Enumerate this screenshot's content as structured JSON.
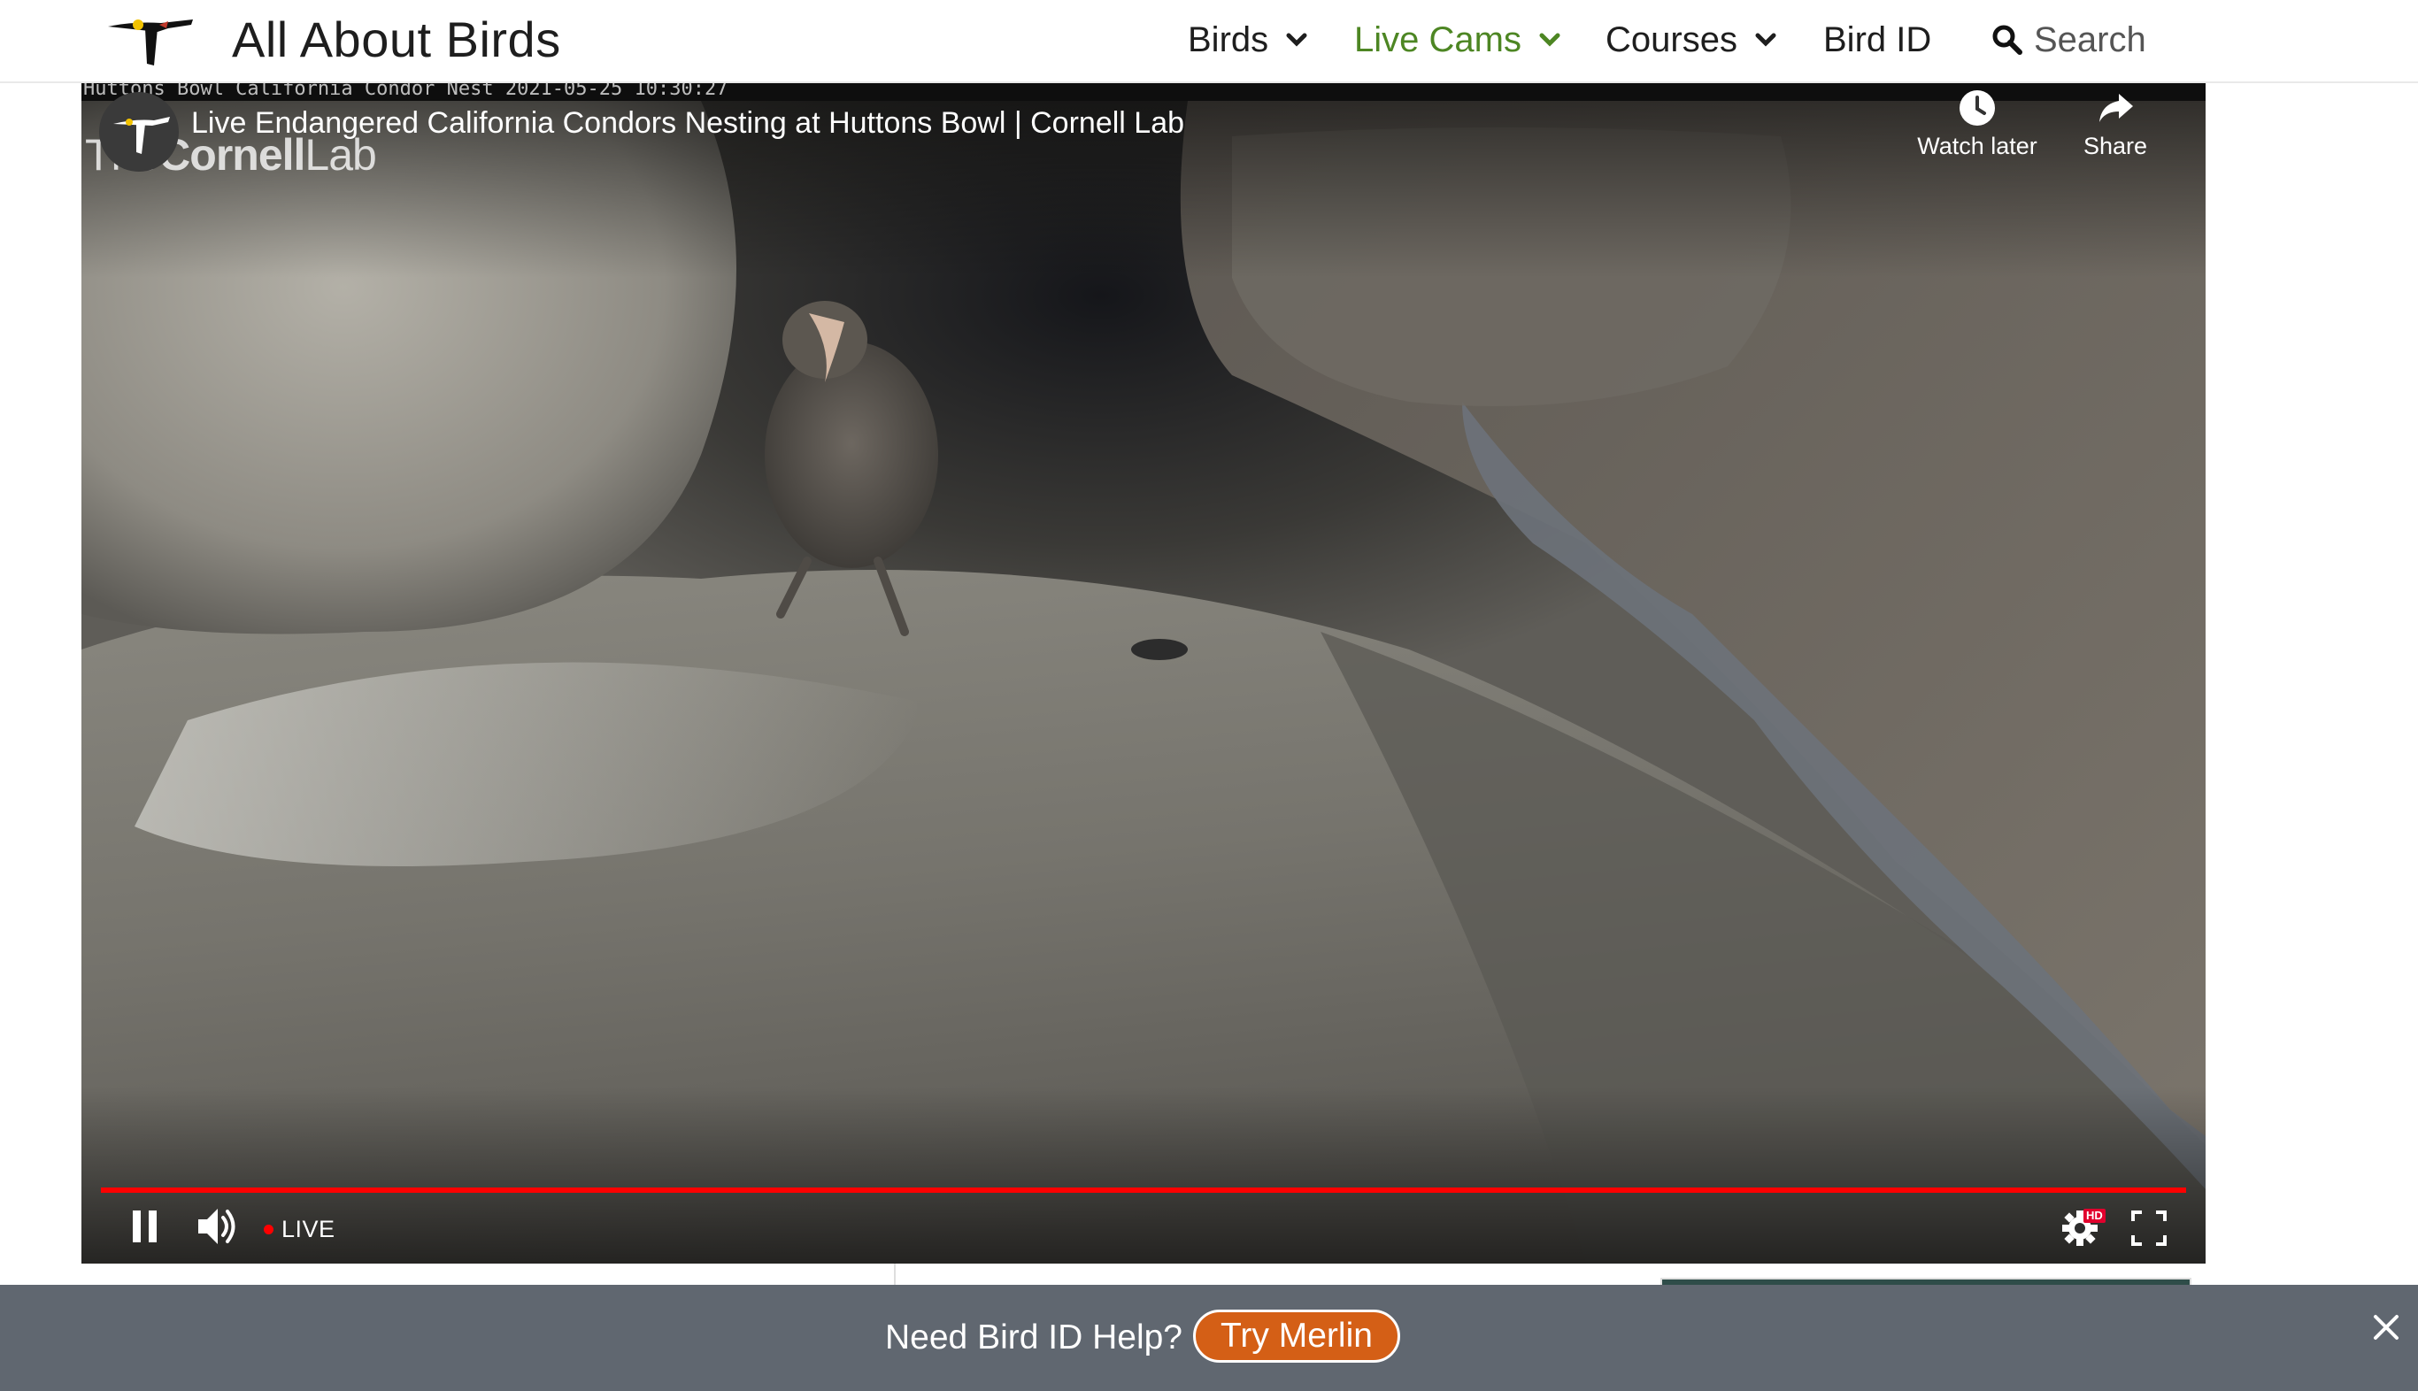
{
  "site": {
    "title": "All About Birds",
    "logo_icon": "cornell-lab-bird-logo-icon"
  },
  "nav": {
    "items": [
      {
        "label": "Birds",
        "has_dropdown": true,
        "active": false
      },
      {
        "label": "Live Cams",
        "has_dropdown": true,
        "active": true
      },
      {
        "label": "Courses",
        "has_dropdown": true,
        "active": false
      },
      {
        "label": "Bird ID",
        "has_dropdown": false,
        "active": false
      }
    ],
    "search_label": "Search",
    "search_icon": "magnifier-icon",
    "active_color": "#4d8623"
  },
  "player": {
    "overlay_timestamp": "Huttons Bowl California Condor Nest 2021-05-25 10:30:27",
    "watermark": {
      "prefix": "The",
      "bold": "Cornell",
      "suffix": "Lab"
    },
    "video_title": "Live Endangered California Condors Nesting at Huttons Bowl | Cornell Lab",
    "watch_later_label": "Watch later",
    "share_label": "Share",
    "live_label": "LIVE",
    "hd_badge": "HD",
    "progress_fraction": 1.0,
    "progress_color": "#ff0000"
  },
  "banner": {
    "text": "Need Bird ID Help?",
    "button_label": "Try Merlin",
    "button_color": "#d45f16",
    "background": "#606770"
  }
}
